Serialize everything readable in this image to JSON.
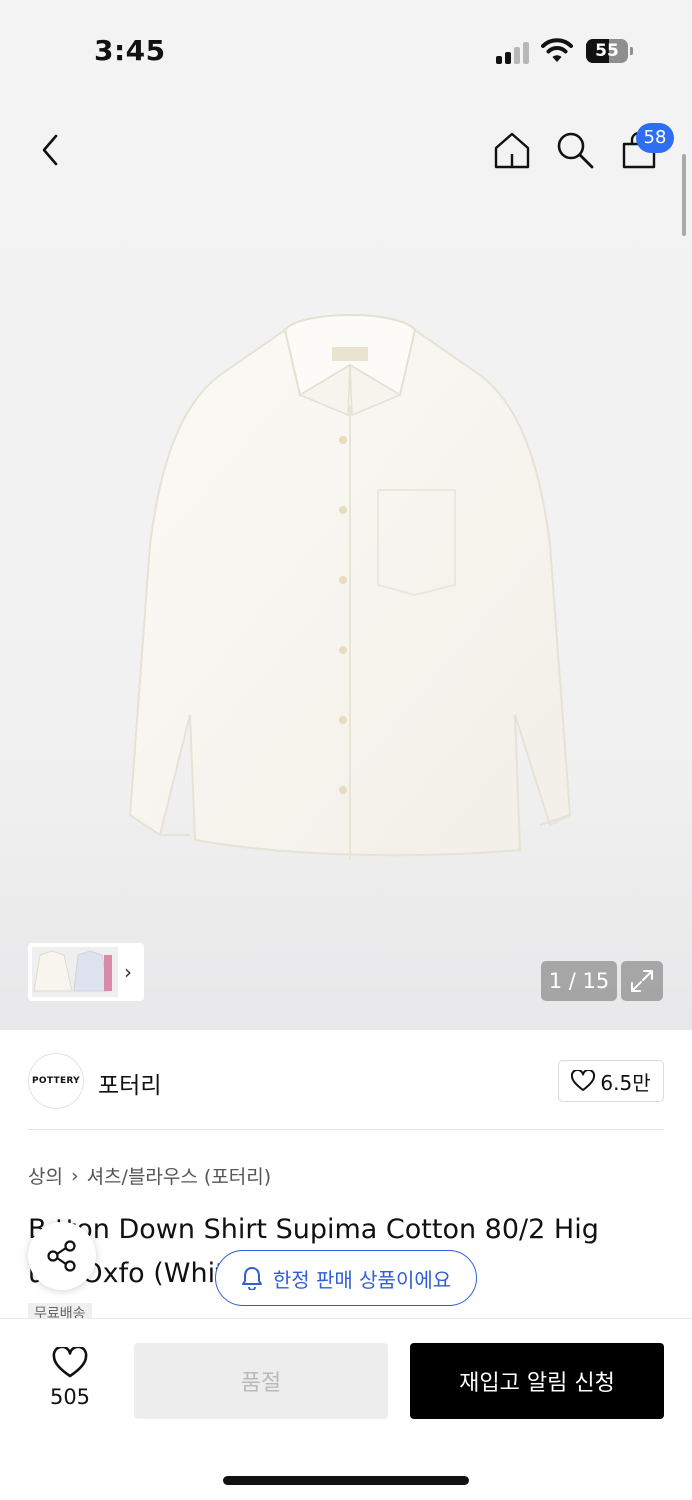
{
  "status_bar": {
    "time": "3:45",
    "battery_level": "55",
    "battery_fraction": 0.55
  },
  "header": {
    "icons": [
      "back-arrow-icon",
      "home-icon",
      "search-icon",
      "shopping-bag-icon"
    ],
    "cart_badge": "58"
  },
  "gallery": {
    "counter": "1 / 15",
    "thumbnail_arrow": "›"
  },
  "brand": {
    "logo_text": "POTTERY",
    "name": "포터리",
    "likes": "6.5만"
  },
  "breadcrumb": {
    "level1": "상의",
    "separator": "›",
    "level2": "셔츠/블라우스 (포터리)"
  },
  "product": {
    "title": "Button Down Shirt Supima Cotton 80/2 High Count Oxford (White)",
    "title_visible": "B  tton Down Shirt Supima Cotton 80/2 Hig\n     unt Oxfo                          (White)",
    "shipping_badge": "무료배송"
  },
  "notice": {
    "limited_text": "한정 판매 상품이에요"
  },
  "bottom_bar": {
    "wish_count": "505",
    "soldout_label": "품절",
    "restock_label": "재입고 알림 신청"
  },
  "colors": {
    "accent_blue": "#2f6df3",
    "pill_blue": "#2f5ed8",
    "primary_button": "#000000",
    "disabled_button": "#ededed"
  }
}
